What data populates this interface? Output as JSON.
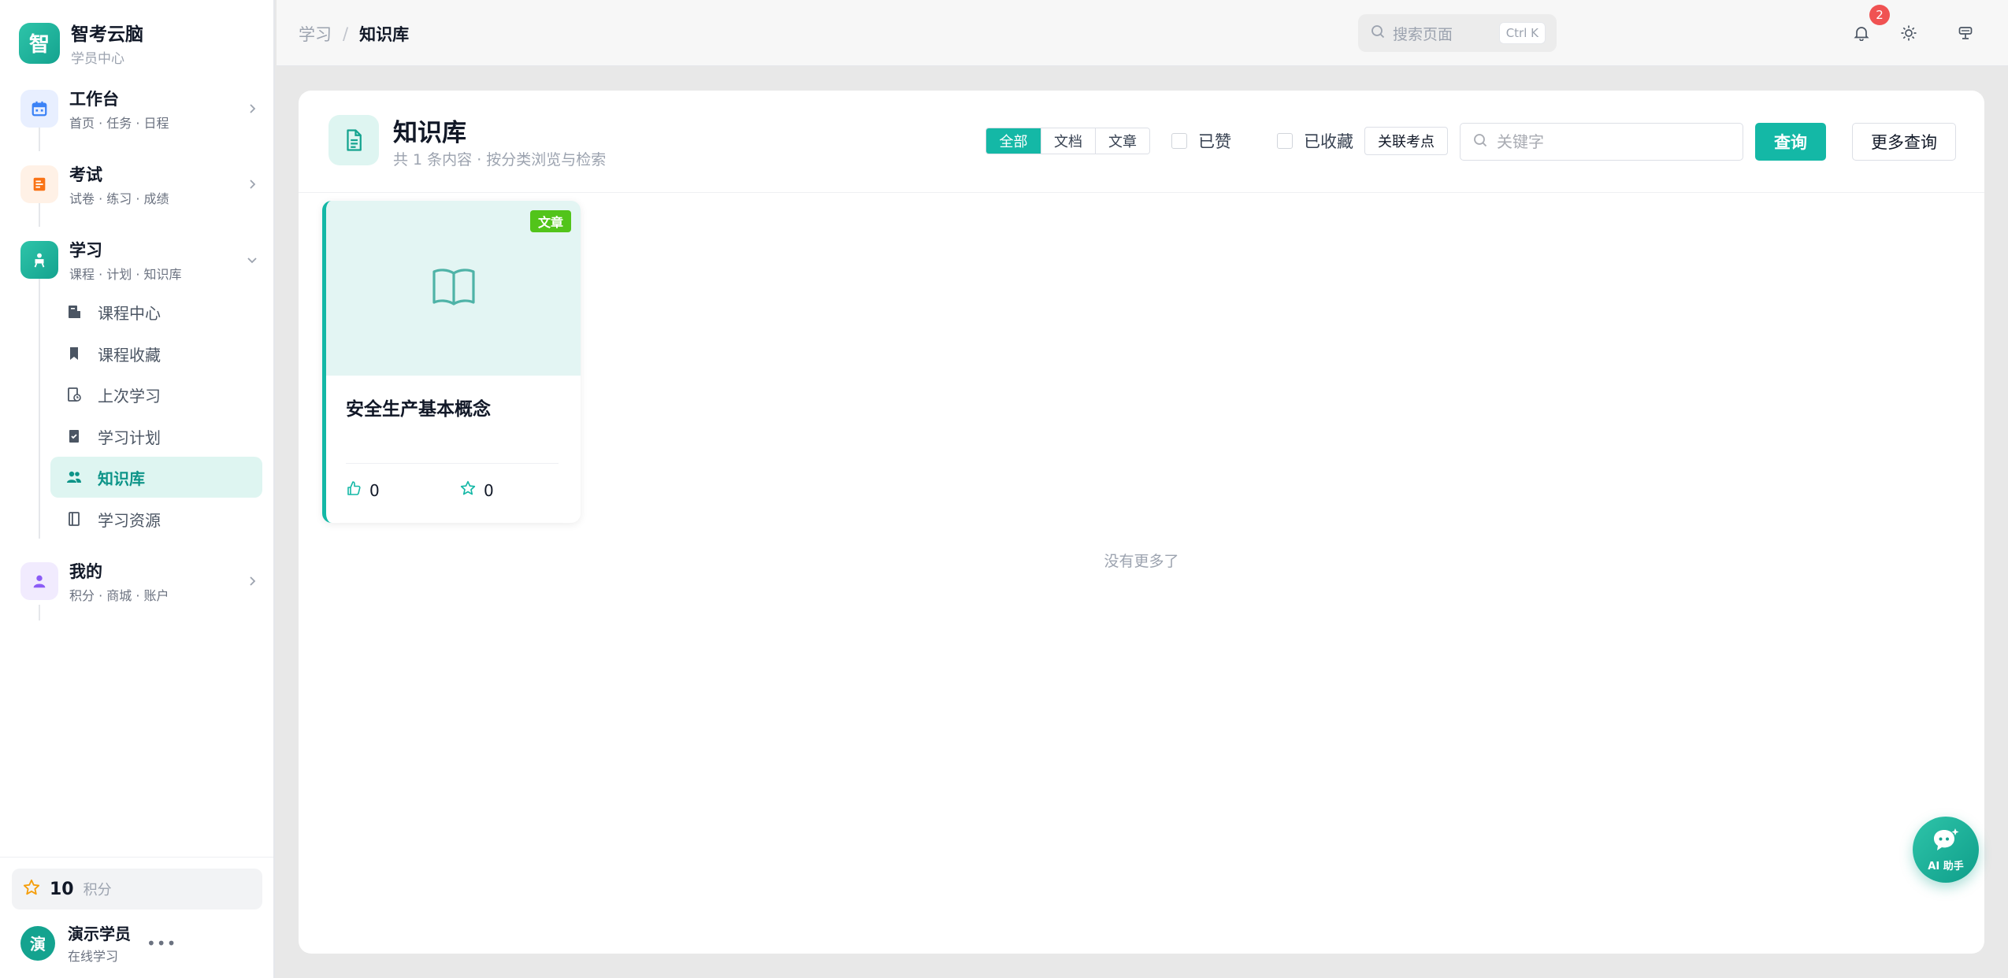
{
  "brand": {
    "name": "智考云脑",
    "subtitle": "学员中心",
    "logo_char": "智"
  },
  "nav": {
    "workbench": {
      "title": "工作台",
      "sub": "首页 · 任务 · 日程",
      "icon": "calendar-icon",
      "color": "#3b82f6"
    },
    "exam": {
      "title": "考试",
      "sub": "试卷 · 练习 · 成绩",
      "icon": "exam-paper-icon",
      "color": "#f97316"
    },
    "study": {
      "title": "学习",
      "sub": "课程 · 计划 · 知识库",
      "icon": "teacher-icon",
      "color": "#14a38f",
      "items": [
        {
          "label": "课程中心",
          "icon": "course-center-icon"
        },
        {
          "label": "课程收藏",
          "icon": "bookmark-icon"
        },
        {
          "label": "上次学习",
          "icon": "history-icon"
        },
        {
          "label": "学习计划",
          "icon": "plan-icon"
        },
        {
          "label": "知识库",
          "icon": "people-icon",
          "active": true
        },
        {
          "label": "学习资源",
          "icon": "notebook-icon"
        }
      ]
    },
    "mine": {
      "title": "我的",
      "sub": "积分 · 商城 · 账户",
      "icon": "user-icon",
      "color": "#8b5cf6"
    }
  },
  "points": {
    "value": "10",
    "unit": "积分"
  },
  "user": {
    "avatar_char": "演",
    "name": "演示学员",
    "status": "在线学习"
  },
  "topbar": {
    "breadcrumb": {
      "parent": "学习",
      "separator": "/",
      "current": "知识库"
    },
    "search": {
      "placeholder": "搜索页面",
      "shortcut": "Ctrl K"
    },
    "notifications_count": "2"
  },
  "page": {
    "title": "知识库",
    "subtitle": "共 1 条内容 · 按分类浏览与检索",
    "filter_tabs": [
      "全部",
      "文档",
      "文章"
    ],
    "active_tab": "全部",
    "liked_label": "已赞",
    "favorited_label": "已收藏",
    "link_points_label": "关联考点",
    "keyword_placeholder": "关键字",
    "query_label": "查询",
    "more_query_label": "更多查询",
    "no_more": "没有更多了"
  },
  "cards": [
    {
      "tag": "文章",
      "title": "安全生产基本概念",
      "likes": "0",
      "favorites": "0"
    }
  ],
  "ai": {
    "label": "AI 助手"
  },
  "colors": {
    "accent": "#14b8a6",
    "tag_green": "#52c41a",
    "badge_red": "#f05252"
  }
}
